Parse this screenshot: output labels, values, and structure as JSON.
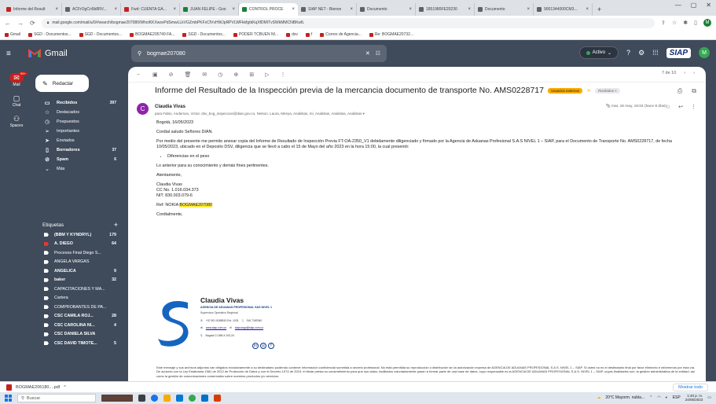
{
  "browser": {
    "tabs": [
      {
        "title": "Informe del Result",
        "color": "#c5221f",
        "active": false
      },
      {
        "title": "ACFrOgCn5b8RV...",
        "color": "#5f6368",
        "active": false
      },
      {
        "title": "Fwd: CUENTA GA...",
        "color": "#c5221f",
        "active": false
      },
      {
        "title": "JUAN FELIPE - Goo",
        "color": "#188038",
        "active": false
      },
      {
        "title": "CONTROL PROCE",
        "color": "#188038",
        "active": true
      },
      {
        "title": "SIAP NET - Bienve",
        "color": "#5f6368",
        "active": false
      },
      {
        "title": "Documento",
        "color": "#5f6368",
        "active": false
      },
      {
        "title": "1851980FE20230",
        "color": "#5f6368",
        "active": false
      },
      {
        "title": "Documento",
        "color": "#5f6368",
        "active": false
      },
      {
        "title": "9001344000CM3...",
        "color": "#5f6368",
        "active": false
      }
    ],
    "new_tab": "+",
    "url": "mail.google.com/mail/u/0/#search/bogmae207080/WhctKKXwsvPdSmwLLkVGZmbPKFxCfVvHWJpRPVLWFkkfgtkKqXfDMITvSWkMMCNBKwfL",
    "bookmarks": [
      "Gmail",
      "SGD - Documentos...",
      "SGD - Documentos...",
      "BOGMAE205749 FA...",
      "SGD - Documentos...",
      "PODER TCBUEN NI...",
      "dsv",
      "f",
      "Correo de Agencia...",
      "Re: BOGMAE20732..."
    ]
  },
  "gmail": {
    "logo": "Gmail",
    "search_value": "bogmae207080",
    "status": "Activo",
    "brand": "SIAP",
    "avatar_letter": "M",
    "rail": [
      {
        "label": "Mail",
        "badge": "99+"
      },
      {
        "label": "Chat"
      },
      {
        "label": "Spaces"
      }
    ],
    "compose": "Redactar",
    "folders": [
      {
        "label": "Recibidos",
        "count": "397",
        "bold": true,
        "icon": "inbox-icon",
        "glyph": "▭"
      },
      {
        "label": "Destacados",
        "count": "",
        "bold": false,
        "icon": "star-icon",
        "glyph": "☆"
      },
      {
        "label": "Pospuestos",
        "count": "",
        "bold": false,
        "icon": "clock-icon",
        "glyph": "◷"
      },
      {
        "label": "Importantes",
        "count": "",
        "bold": false,
        "icon": "important-icon",
        "glyph": "➢"
      },
      {
        "label": "Enviados",
        "count": "",
        "bold": false,
        "icon": "send-icon",
        "glyph": "➤"
      },
      {
        "label": "Borradores",
        "count": "37",
        "bold": true,
        "icon": "draft-icon",
        "glyph": "▯"
      },
      {
        "label": "Spam",
        "count": "6",
        "bold": true,
        "icon": "spam-icon",
        "glyph": "⊘"
      },
      {
        "label": "Más",
        "count": "",
        "bold": false,
        "icon": "chevron-down-icon",
        "glyph": "⌄"
      }
    ],
    "labels_title": "Etiquetas",
    "labels_add": "+",
    "labels": [
      {
        "label": "(BBM Y KYNDRYL)",
        "count": "179",
        "bold": true,
        "color": "#fff"
      },
      {
        "label": "A. DIEGO",
        "count": "64",
        "bold": true,
        "color": "#e53935"
      },
      {
        "label": "Procesos Final Diego S...",
        "count": "",
        "bold": false,
        "color": "#fff"
      },
      {
        "label": "ANGELA VARGAS",
        "count": "",
        "bold": false,
        "color": "#fff"
      },
      {
        "label": "ANGELICA",
        "count": "9",
        "bold": true,
        "color": "#fff"
      },
      {
        "label": "baker",
        "count": "32",
        "bold": true,
        "color": "#fff"
      },
      {
        "label": "CAPACITACIONES Y MA...",
        "count": "",
        "bold": false,
        "color": "#fff"
      },
      {
        "label": "Cartera",
        "count": "",
        "bold": false,
        "color": "#fff"
      },
      {
        "label": "COMPROBANTES DE PA...",
        "count": "",
        "bold": false,
        "color": "#fff"
      },
      {
        "label": "CSC CAMILA ROJ...",
        "count": "28",
        "bold": true,
        "color": "#fff"
      },
      {
        "label": "CSC CAROLINA NI...",
        "count": "4",
        "bold": true,
        "color": "#fff"
      },
      {
        "label": "CSC DANIELA SILVA",
        "count": "",
        "bold": true,
        "color": "#fff"
      },
      {
        "label": "CSC DAVID TIMOTE...",
        "count": "5",
        "bold": true,
        "color": "#fff"
      }
    ],
    "pager": "7 de 10"
  },
  "message": {
    "subject": "Informe del Resultado de la Inspección previa de la mercancia documento de transporte No. AMS0228717",
    "chips": [
      {
        "text": "Usuarios externos",
        "bg": "#f9ab00",
        "fg": "#202124"
      },
      {
        "text": "Recibidos ×",
        "bg": "#e8eaed",
        "fg": "#5f6368"
      }
    ],
    "sender": "Claudia Vivas",
    "sender_initial": "C",
    "to": "para Fabio, Anderson, Victor, dsv_bog_inspeccion@dian.gov.co, Nelson, Laura, Mireya, Analistas, mí, Analistas, Analistas, Analistas ▾",
    "date": "mar, 16 may, 16:04 (hace 8 días)",
    "body": {
      "location_date": "Bogotá, 16/05/2023",
      "greeting": "Cordial saludo Señores DIAN.",
      "paragraph": "Por medio del presente me permito anexar copia del Informe de Resultado de Inspección Previa FT-OA-2350_V1 debidamente diligenciado y firmado por la Agencia de Aduanas Profesional S.A.S NIVEL 1 – SIAP, para el Documento de Transporte No. AMS0228717, de fecha 10/05/2023, ubicado en el Deposito DSV, diligencia que se llevó a cabo el 15 de Mayo del año 2023 en la hora 15:00, la cual presentó:",
      "bullet": "Diferencias en el peso",
      "closing": "Lo anterior para su conocimiento y demás fines pertinentes.",
      "regards": "Atentamente,",
      "sig1": "Claudia Vivas",
      "sig2": "CC No. 1.016.034.373",
      "sig3": "NIT: 830.003.079-6",
      "ref_prefix": "Ref: NOKIA",
      "ref_highlight": "BOGMAE207080",
      "cordially": "Cordialmente,"
    },
    "signature": {
      "name": "Claudia Vivas",
      "company": "AGENCIA DE ADUANAS PROFESIONAL SAS NIVEL 1",
      "role": "Supervisor Operativo Regional",
      "phone": "+57 601 8188510 Ext. 1031",
      "mobile": "316 7182940",
      "web": "www.siap.com.co",
      "email": "siapcargo@siap.com.co",
      "address": "Bogotá CI 26B # 103-24"
    },
    "disclaimer": "Este mensaje y sus archivos adjuntos van dirigidos exclusivamente a su destinatario pudiendo contener información confidencial sometida a secreto profesional. No está permitida su reproducción o distribución sin la autorización expresa de AGENCIA DE ADUANAS PROFESIONAL S.A.S. NIVEL 1 – SIAP. Si usted no es el destinatario final por favor elimínelo e infórmenos por esta vía. De acuerdo con la Ley Estatutaria 1581 de 2012 de Protección de Datos y con el Decreto 1074 de 2015, el titular presta su consentimiento para que sus datos, facilitados voluntariamente pasen a formar parte de una base de datos, cuyo responsable es la AGENCIA DE ADUANAS PROFESIONAL S.A.S. NIVEL 1 – SIAP, cuyas finalidades son: la gestión administrativa de la entidad, así como la gestión de comunicaciones comerciales sobre nuestros productos y/o servicios."
  },
  "download": {
    "file": "BOGMAE206180....pdf",
    "show_all": "Mostrar todo"
  },
  "taskbar": {
    "search": "Buscar",
    "weather": "20°C  Mayorm. nubla...",
    "lang": "ESP",
    "time": "1:40 p. m.",
    "date": "24/05/2023"
  }
}
